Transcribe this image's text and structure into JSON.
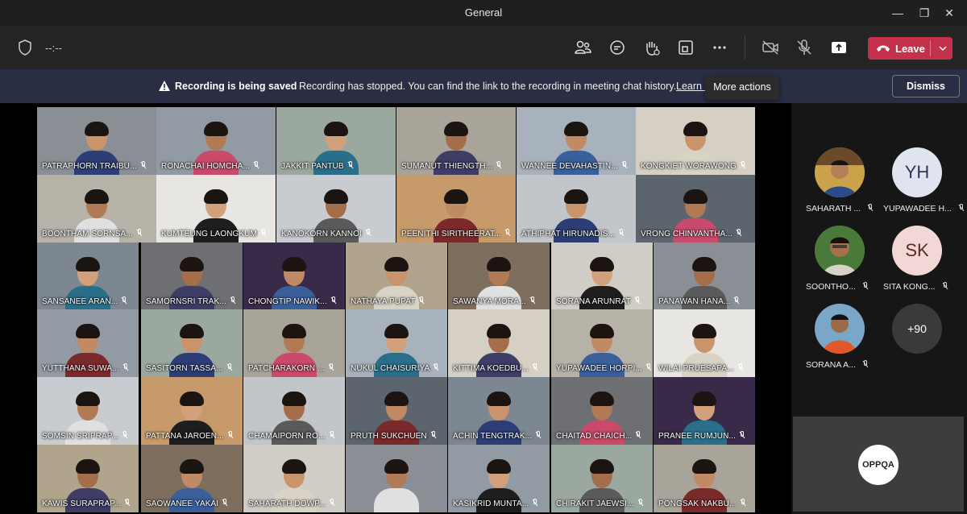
{
  "window": {
    "title": "General",
    "minimize": "—",
    "maximize": "❐",
    "close": "✕"
  },
  "toolbar": {
    "timer": "--:--",
    "leave_label": "Leave"
  },
  "banner": {
    "title": "Recording is being saved",
    "message": "Recording has stopped. You can find the link to the recording in meeting chat history.",
    "link": "Learn m",
    "dismiss": "Dismiss",
    "tooltip": "More actions"
  },
  "participants": [
    "PATRAPHORN TRAIBU...",
    "RONACHAI HOMCHA...",
    "JAKKIT PANTUB",
    "SUMANUT THIENGTH...",
    "WANNEE DEVAHASTIN...",
    "KONGKIET WORAWONG",
    "BOONTHAM SORNSA...",
    "KUMTEUNG LAONGKUM",
    "KANOKORN KANNOI",
    "PEENITHI SIRITHEERAT...",
    "ATHIPHAT HIRUNADIS...",
    "VRONG CHINVANTHA...",
    "SANSANEE ARAN...",
    "SAMORNSRI TRAK...",
    "CHONGTIP NAWIK...",
    "NATHAYA PUPAT",
    "SAWANYA MORA...",
    "SORANA ARUNRAT",
    "PANAWAN HANA...",
    "YUTTHANA SUWA...",
    "SASITORN TASSA...",
    "PATCHARAKORN ...",
    "NUKUL CHAISURIYA",
    "KITTIMA KOEDBU...",
    "YUPAWADEE HORPI...",
    "WILAI PRUESAPA...",
    "SOMSIN SRIPRAP...",
    "PATTANA JAROEN...",
    "CHAMAIPORN RO...",
    "PRUTH SUKCHUEN",
    "ACHIN TENGTRAK...",
    "CHAITAD CHAICH...",
    "PRANEE RUMJUN...",
    "KAWIS SURAPRAP...",
    "SAOWANEE YAKAI",
    "SAHARATH DOWP...",
    "",
    "KASIKRID MUNTA...",
    "CHIRAKIT JAEWSI...",
    "PONGSAK NAKBU..."
  ],
  "sidepanel": {
    "people": [
      {
        "label": "SAHARATH ...",
        "initials": ""
      },
      {
        "label": "YUPAWADEE H...",
        "initials": "YH"
      },
      {
        "label": "SOONTHO...",
        "initials": ""
      },
      {
        "label": "SITA KONG...",
        "initials": "SK"
      },
      {
        "label": "SORANA A...",
        "initials": ""
      }
    ],
    "overflow": "+90",
    "self_badge": "OPPQA"
  }
}
